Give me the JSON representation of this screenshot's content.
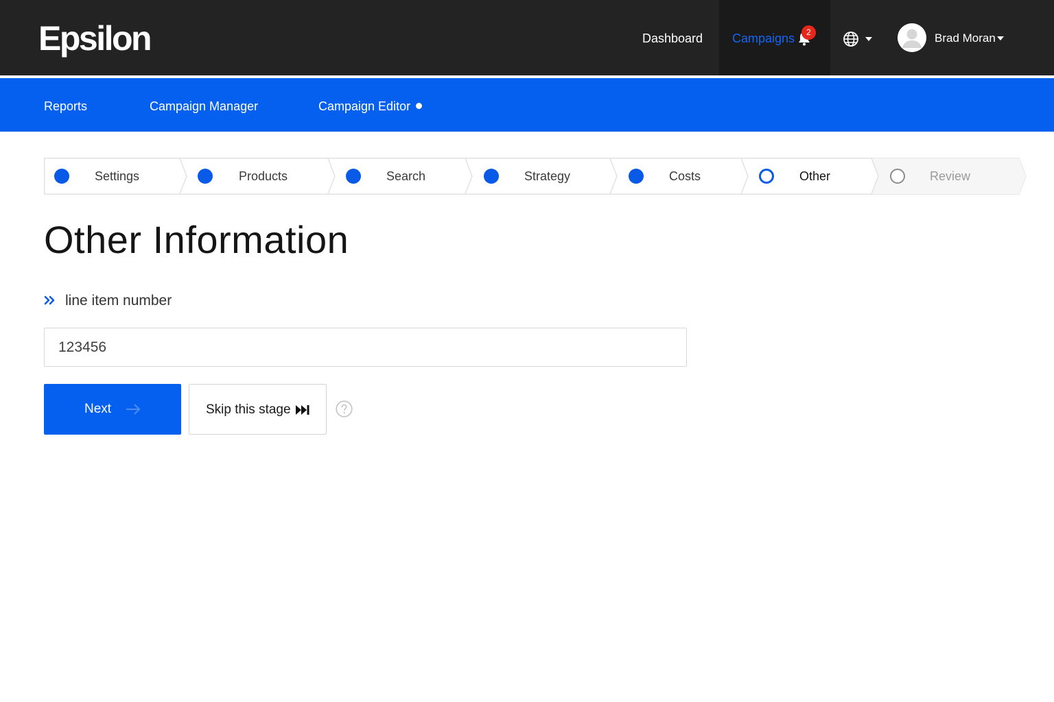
{
  "header": {
    "logo": "Epsilon",
    "nav": {
      "dashboard": "Dashboard",
      "campaigns": "Campaigns"
    },
    "notification_count": "2",
    "user_name": "Brad Moran"
  },
  "subnav": {
    "items": [
      {
        "label": "Reports"
      },
      {
        "label": "Campaign Manager"
      },
      {
        "label": "Campaign Editor",
        "has_dot": true
      }
    ]
  },
  "stepper": {
    "steps": [
      {
        "label": "Settings",
        "state": "done"
      },
      {
        "label": "Products",
        "state": "done"
      },
      {
        "label": "Search",
        "state": "done"
      },
      {
        "label": "Strategy",
        "state": "done"
      },
      {
        "label": "Costs",
        "state": "done"
      },
      {
        "label": "Other",
        "state": "current"
      },
      {
        "label": "Review",
        "state": "pending"
      }
    ]
  },
  "main": {
    "title": "Other Information",
    "field": {
      "label": "line item number",
      "value": "123456"
    },
    "buttons": {
      "next": "Next",
      "skip": "Skip this stage"
    }
  },
  "colors": {
    "topbar": "#232323",
    "accent_blue": "#0660ef",
    "badge_red": "#e8271c"
  },
  "icons": [
    "bell-icon",
    "globe-icon",
    "avatar",
    "chevrons-right-icon",
    "arrow-right-icon",
    "skip-forward-icon",
    "help-icon"
  ]
}
